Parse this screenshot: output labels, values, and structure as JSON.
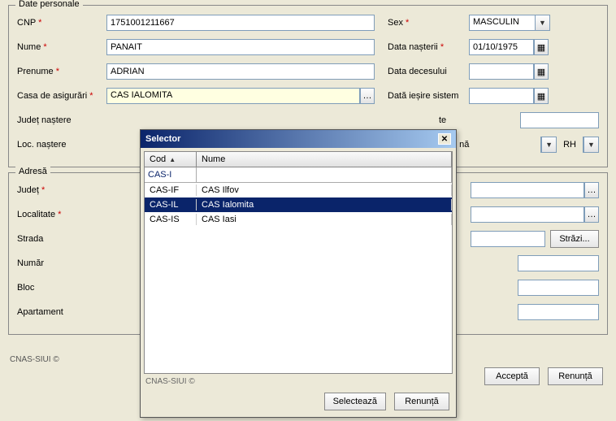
{
  "groups": {
    "personal": "Date personale",
    "address": "Adresă"
  },
  "labels": {
    "cnp": "CNP",
    "nume": "Nume",
    "prenume": "Prenume",
    "casa": "Casa de asigurări",
    "judet_nastere": "Județ naștere",
    "loc_nastere": "Loc. naștere",
    "sex": "Sex",
    "data_nasterii": "Data nașterii",
    "data_decesului": "Data decesului",
    "data_iesire": "Dată ieșire sistem",
    "act_te": "te",
    "nr_na": "nă",
    "rh": "RH",
    "judet": "Județ",
    "localitate": "Localitate",
    "strada": "Strada",
    "numar": "Număr",
    "bloc": "Bloc",
    "apartament": "Apartament",
    "strazi_btn": "Străzi..."
  },
  "values": {
    "cnp": "1751001211667",
    "nume": "PANAIT",
    "prenume": "ADRIAN",
    "casa": "CAS IALOMITA",
    "sex": "MASCULIN",
    "data_nasterii": "01/10/1975"
  },
  "buttons": {
    "accepta": "Acceptă",
    "renunta": "Renunță",
    "select": "Selectează"
  },
  "copyright": "CNAS-SIUI ©",
  "selector": {
    "title": "Selector",
    "col_cod": "Cod",
    "col_nume": "Nume",
    "filter_cod": "CAS-I",
    "filter_nume": "",
    "rows": [
      {
        "cod": "CAS-IF",
        "nume": "CAS  Ilfov",
        "selected": false
      },
      {
        "cod": "CAS-IL",
        "nume": "CAS  Ialomita",
        "selected": true
      },
      {
        "cod": "CAS-IS",
        "nume": "CAS  Iasi",
        "selected": false
      }
    ],
    "copyright": "CNAS-SIUI ©"
  }
}
